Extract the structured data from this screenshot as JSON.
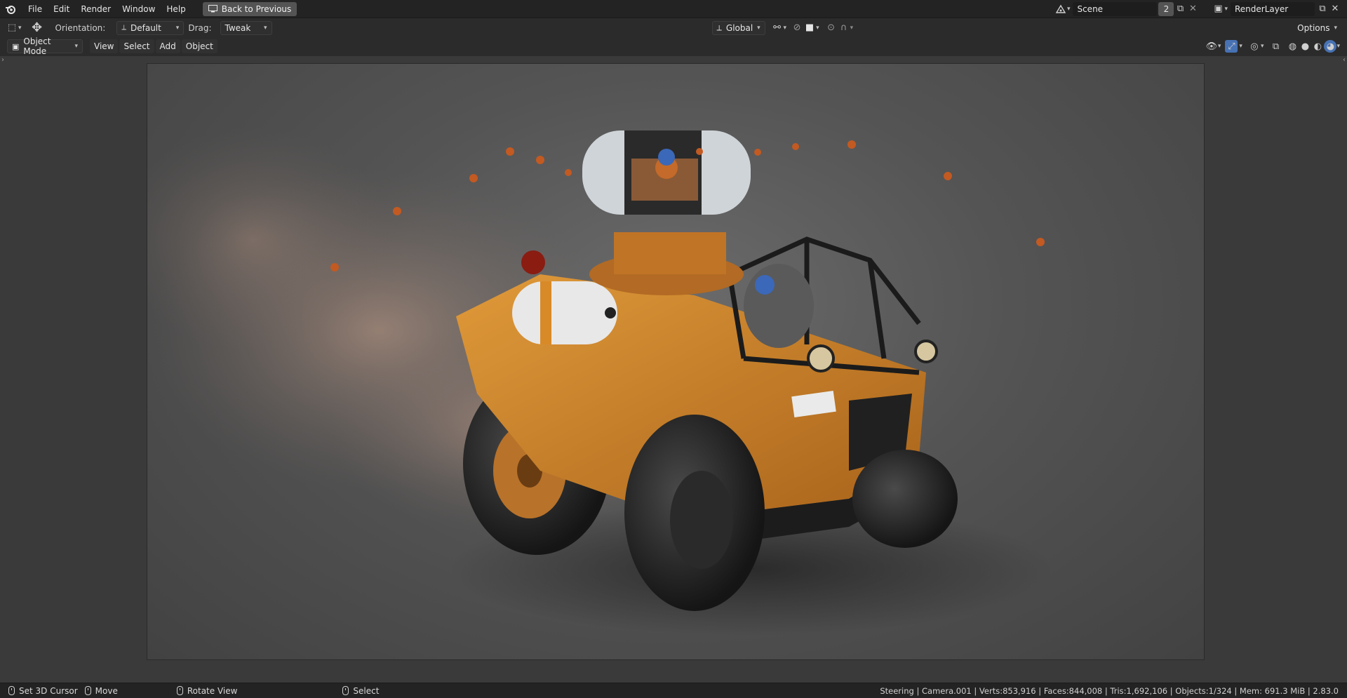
{
  "app": {
    "menu": [
      "File",
      "Edit",
      "Render",
      "Window",
      "Help"
    ],
    "back_button": "Back to Previous",
    "scene": {
      "name": "Scene",
      "count": "2"
    },
    "render_layer": "RenderLayer"
  },
  "toolbar": {
    "orientation_label": "Orientation:",
    "orientation_value": "Default",
    "drag_label": "Drag:",
    "drag_value": "Tweak",
    "transform_space": "Global",
    "options_label": "Options"
  },
  "header": {
    "mode": "Object Mode",
    "menus": [
      "View",
      "Select",
      "Add",
      "Object"
    ]
  },
  "status": {
    "hints": [
      "Set 3D Cursor",
      "Move",
      "Rotate View",
      "Select"
    ],
    "info": "Steering | Camera.001 | Verts:853,916 | Faces:844,008 | Tris:1,692,106 | Objects:1/324 | Mem: 691.3 MiB | 2.83.0"
  },
  "colors": {
    "vehicle_orange": "#d98a28",
    "accent_blue": "#4772b3"
  }
}
